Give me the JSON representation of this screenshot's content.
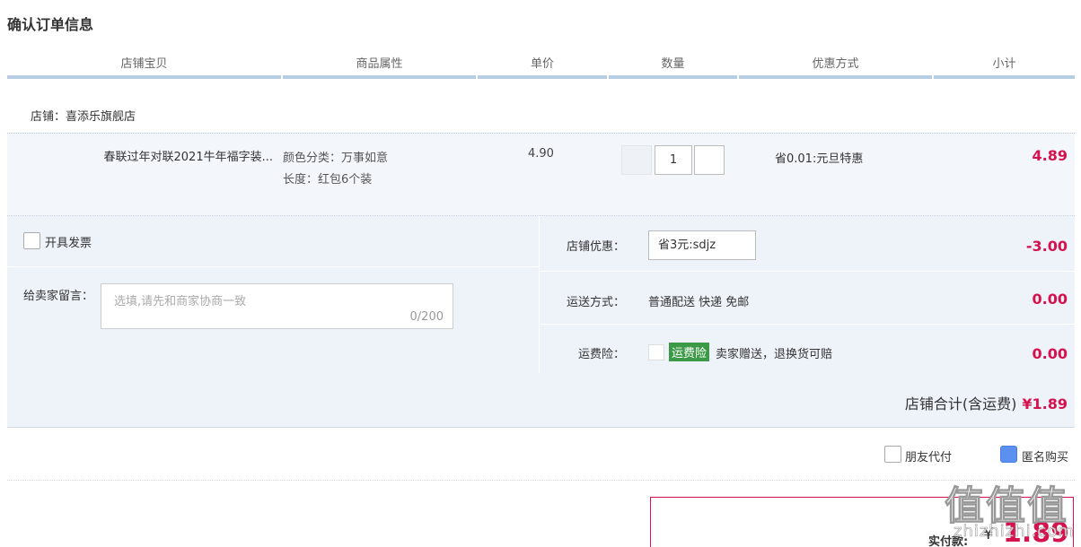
{
  "page_title": "确认订单信息",
  "table_headers": [
    "店铺宝贝",
    "商品属性",
    "单价",
    "数量",
    "优惠方式",
    "小计"
  ],
  "shop": {
    "label": "店铺：",
    "name": "喜添乐旗舰店"
  },
  "item": {
    "title": "春联过年对联2021牛年福字装...",
    "attr_color": "颜色分类：万事如意",
    "attr_length": "长度：红包6个装",
    "unit_price": "4.90",
    "quantity": "1",
    "discount": "省0.01:元旦特惠",
    "subtotal": "4.89"
  },
  "invoice": {
    "label": "开具发票"
  },
  "message": {
    "label": "给卖家留言：",
    "placeholder": "选填,请先和商家协商一致",
    "count": "0/200"
  },
  "store_coupon": {
    "label": "店铺优惠：",
    "selected": "省3元:sdjz",
    "value": "-3.00"
  },
  "shipping": {
    "label": "运送方式：",
    "text": "普通配送 快递 免邮",
    "value": "0.00"
  },
  "insurance": {
    "label": "运费险：",
    "badge": "运费险",
    "text": "卖家赠送，退换货可赔",
    "value": "0.00"
  },
  "shop_total": {
    "label": "店铺合计(含运费)",
    "amount": "¥1.89"
  },
  "friend_pay": {
    "label": "朋友代付"
  },
  "anonymous": {
    "label": "匿名购买",
    "checked": true
  },
  "pay": {
    "label": "实付款:",
    "currency": "¥",
    "amount": "1.89"
  },
  "watermark": {
    "logo": "值值值",
    "site": "zhizhizhi.com"
  },
  "colors": {
    "accent_red": "#d6124e",
    "badge_green": "#3c9a47",
    "checkbox_blue": "#5b8ff0"
  }
}
